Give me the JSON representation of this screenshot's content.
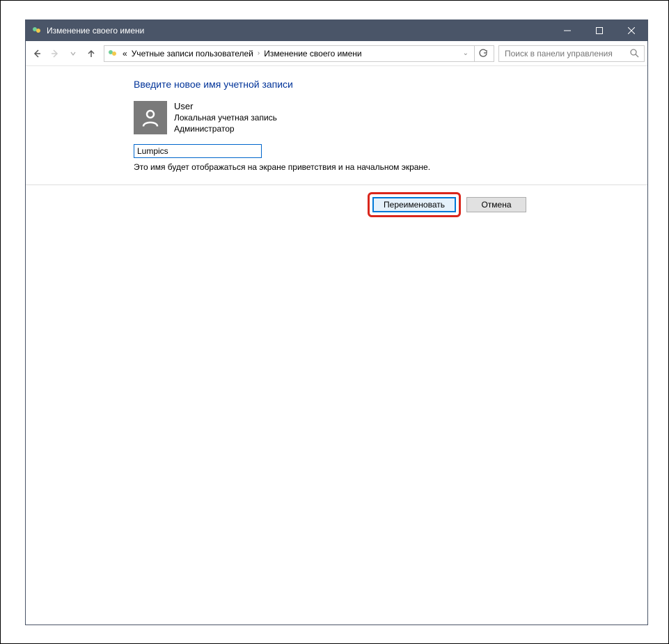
{
  "titlebar": {
    "title": "Изменение своего имени"
  },
  "breadcrumb": {
    "prefix": "«",
    "seg1": "Учетные записи пользователей",
    "seg2": "Изменение своего имени"
  },
  "search": {
    "placeholder": "Поиск в панели управления"
  },
  "main": {
    "heading": "Введите новое имя учетной записи",
    "user": {
      "name": "User",
      "type": "Локальная учетная запись",
      "role": "Администратор"
    },
    "input_value": "Lumpics",
    "hint": "Это имя будет отображаться на экране приветствия и на начальном экране."
  },
  "buttons": {
    "rename": "Переименовать",
    "cancel": "Отмена"
  }
}
